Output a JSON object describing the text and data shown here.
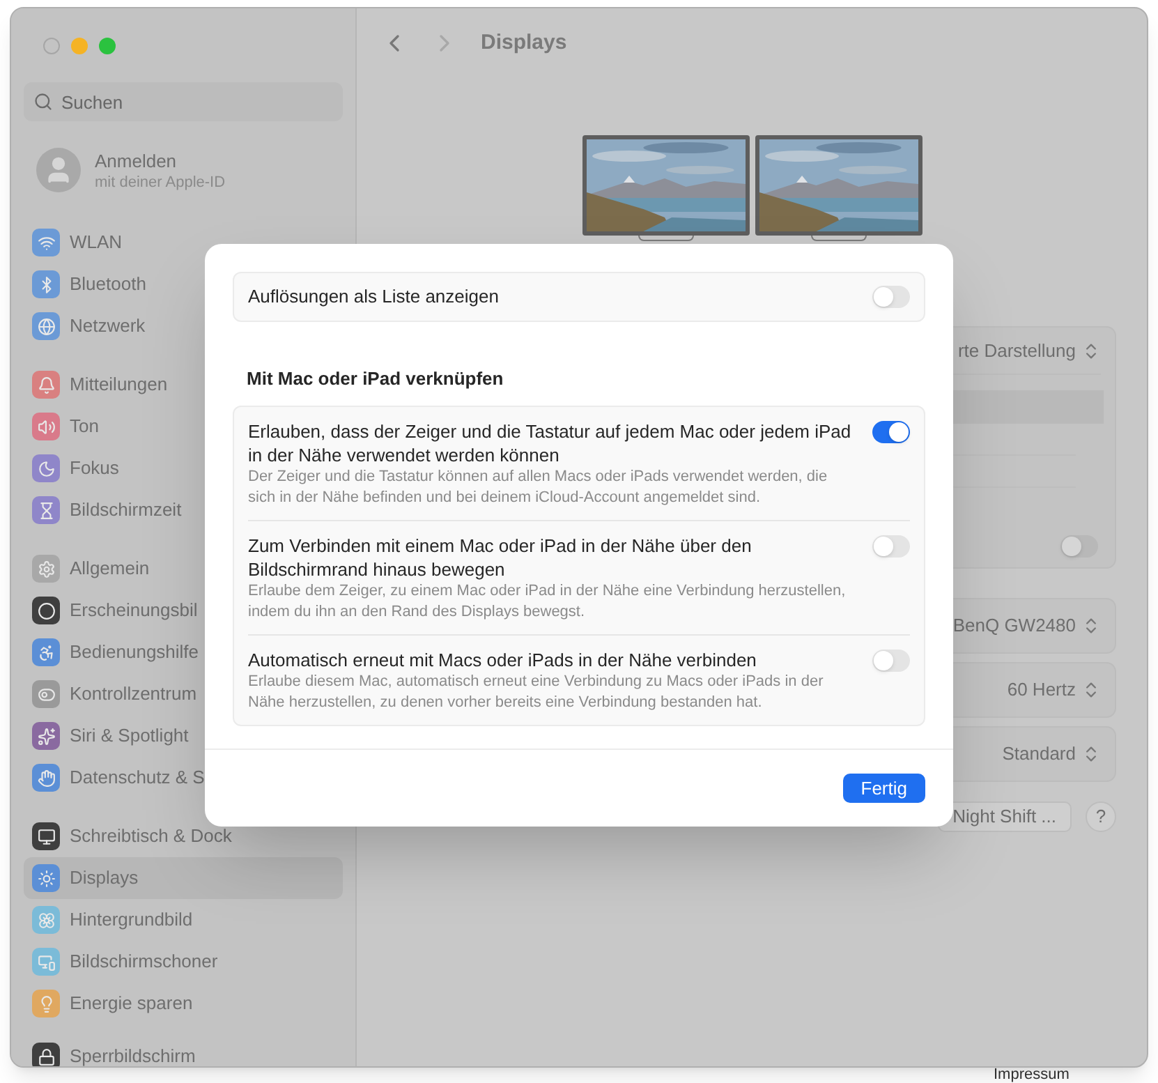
{
  "window": {
    "title": "Displays",
    "nav": {
      "back_enabled": true,
      "forward_enabled": false
    }
  },
  "sidebar": {
    "search": {
      "placeholder": "Suchen"
    },
    "account": {
      "name": "Anmelden",
      "subtitle": "mit deiner Apple-ID"
    },
    "groups": [
      [
        {
          "label": "WLAN",
          "color": "#6b9ad6",
          "selected": false
        },
        {
          "label": "Bluetooth",
          "color": "#6b9ad6",
          "selected": false
        },
        {
          "label": "Netzwerk",
          "color": "#6b9ad6",
          "selected": false
        }
      ],
      [
        {
          "label": "Mitteilungen",
          "color": "#d98080",
          "selected": false
        },
        {
          "label": "Ton",
          "color": "#d97a8a",
          "selected": false
        },
        {
          "label": "Fokus",
          "color": "#8f86c9",
          "selected": false
        },
        {
          "label": "Bildschirmzeit",
          "color": "#8f86c9",
          "selected": false
        }
      ],
      [
        {
          "label": "Allgemein",
          "color": "#a8a8a8",
          "selected": false
        },
        {
          "label": "Erscheinungsbil",
          "color": "#3f3f3f",
          "selected": false
        },
        {
          "label": "Bedienungshilfe",
          "color": "#5b8fd6",
          "selected": false
        },
        {
          "label": "Kontrollzentrum",
          "color": "#9a9a9a",
          "selected": false
        },
        {
          "label": "Siri & Spotlight",
          "color": "#8a6aa0",
          "selected": false
        },
        {
          "label": "Datenschutz & S",
          "color": "#5b8fd6",
          "selected": false
        }
      ],
      [
        {
          "label": "Schreibtisch & Dock",
          "color": "#3f3f3f",
          "selected": false
        },
        {
          "label": "Displays",
          "color": "#5b8fd6",
          "selected": true
        },
        {
          "label": "Hintergrundbild",
          "color": "#7bbbd8",
          "selected": false
        },
        {
          "label": "Bildschirmschoner",
          "color": "#7bbbd8",
          "selected": false
        },
        {
          "label": "Energie sparen",
          "color": "#e0a860",
          "selected": false
        }
      ],
      [
        {
          "label": "Sperrbildschirm",
          "color": "#3f3f3f",
          "selected": false
        }
      ]
    ]
  },
  "main": {
    "settings_box": [
      {
        "kind": "popup",
        "value": "rte Darstellung"
      },
      {
        "kind": "highlight"
      },
      {
        "kind": "blank"
      },
      {
        "kind": "blank"
      },
      {
        "kind": "toggle",
        "on": false
      }
    ],
    "popups": [
      {
        "value": "BenQ GW2480"
      },
      {
        "value": "60 Hertz"
      },
      {
        "value": "Standard"
      }
    ],
    "night_shift_button": "Night Shift ...",
    "help_button": "?"
  },
  "sheet": {
    "resolution_list": {
      "label": "Auflösungen als Liste anzeigen",
      "on": false
    },
    "section_title": "Mit Mac oder iPad verknüpfen",
    "options": [
      {
        "title": "Erlauben, dass der Zeiger und die Tastatur auf jedem Mac oder jedem iPad in der Nähe verwendet werden können",
        "description": "Der Zeiger und die Tastatur können auf allen Macs oder iPads verwendet werden, die sich in der Nähe befinden und bei deinem iCloud-Account angemeldet sind.",
        "on": true
      },
      {
        "title": "Zum Verbinden mit einem Mac oder iPad in der Nähe über den Bildschirmrand hinaus bewegen",
        "description": "Erlaube dem Zeiger, zu einem Mac oder iPad in der Nähe eine Verbindung herzustellen, indem du ihn an den Rand des Displays bewegst.",
        "on": false
      },
      {
        "title": "Automatisch erneut mit Macs oder iPads in der Nähe verbinden",
        "description": "Erlaube diesem Mac, automatisch erneut eine Verbindung zu Macs oder iPads in der Nähe herzustellen, zu denen vorher bereits eine Verbindung bestanden hat.",
        "on": false
      }
    ],
    "done_button": "Fertig"
  },
  "web_footer": {
    "link": "Impressum"
  }
}
